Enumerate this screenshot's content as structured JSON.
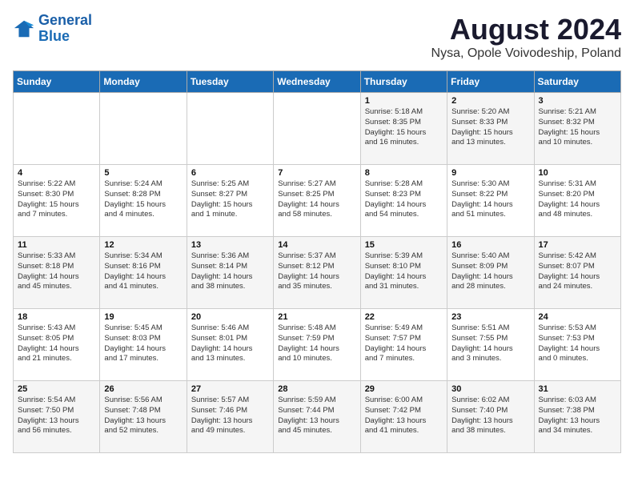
{
  "header": {
    "logo_line1": "General",
    "logo_line2": "Blue",
    "title": "August 2024",
    "subtitle": "Nysa, Opole Voivodeship, Poland"
  },
  "weekdays": [
    "Sunday",
    "Monday",
    "Tuesday",
    "Wednesday",
    "Thursday",
    "Friday",
    "Saturday"
  ],
  "weeks": [
    [
      {
        "day": "",
        "info": ""
      },
      {
        "day": "",
        "info": ""
      },
      {
        "day": "",
        "info": ""
      },
      {
        "day": "",
        "info": ""
      },
      {
        "day": "1",
        "info": "Sunrise: 5:18 AM\nSunset: 8:35 PM\nDaylight: 15 hours\nand 16 minutes."
      },
      {
        "day": "2",
        "info": "Sunrise: 5:20 AM\nSunset: 8:33 PM\nDaylight: 15 hours\nand 13 minutes."
      },
      {
        "day": "3",
        "info": "Sunrise: 5:21 AM\nSunset: 8:32 PM\nDaylight: 15 hours\nand 10 minutes."
      }
    ],
    [
      {
        "day": "4",
        "info": "Sunrise: 5:22 AM\nSunset: 8:30 PM\nDaylight: 15 hours\nand 7 minutes."
      },
      {
        "day": "5",
        "info": "Sunrise: 5:24 AM\nSunset: 8:28 PM\nDaylight: 15 hours\nand 4 minutes."
      },
      {
        "day": "6",
        "info": "Sunrise: 5:25 AM\nSunset: 8:27 PM\nDaylight: 15 hours\nand 1 minute."
      },
      {
        "day": "7",
        "info": "Sunrise: 5:27 AM\nSunset: 8:25 PM\nDaylight: 14 hours\nand 58 minutes."
      },
      {
        "day": "8",
        "info": "Sunrise: 5:28 AM\nSunset: 8:23 PM\nDaylight: 14 hours\nand 54 minutes."
      },
      {
        "day": "9",
        "info": "Sunrise: 5:30 AM\nSunset: 8:22 PM\nDaylight: 14 hours\nand 51 minutes."
      },
      {
        "day": "10",
        "info": "Sunrise: 5:31 AM\nSunset: 8:20 PM\nDaylight: 14 hours\nand 48 minutes."
      }
    ],
    [
      {
        "day": "11",
        "info": "Sunrise: 5:33 AM\nSunset: 8:18 PM\nDaylight: 14 hours\nand 45 minutes."
      },
      {
        "day": "12",
        "info": "Sunrise: 5:34 AM\nSunset: 8:16 PM\nDaylight: 14 hours\nand 41 minutes."
      },
      {
        "day": "13",
        "info": "Sunrise: 5:36 AM\nSunset: 8:14 PM\nDaylight: 14 hours\nand 38 minutes."
      },
      {
        "day": "14",
        "info": "Sunrise: 5:37 AM\nSunset: 8:12 PM\nDaylight: 14 hours\nand 35 minutes."
      },
      {
        "day": "15",
        "info": "Sunrise: 5:39 AM\nSunset: 8:10 PM\nDaylight: 14 hours\nand 31 minutes."
      },
      {
        "day": "16",
        "info": "Sunrise: 5:40 AM\nSunset: 8:09 PM\nDaylight: 14 hours\nand 28 minutes."
      },
      {
        "day": "17",
        "info": "Sunrise: 5:42 AM\nSunset: 8:07 PM\nDaylight: 14 hours\nand 24 minutes."
      }
    ],
    [
      {
        "day": "18",
        "info": "Sunrise: 5:43 AM\nSunset: 8:05 PM\nDaylight: 14 hours\nand 21 minutes."
      },
      {
        "day": "19",
        "info": "Sunrise: 5:45 AM\nSunset: 8:03 PM\nDaylight: 14 hours\nand 17 minutes."
      },
      {
        "day": "20",
        "info": "Sunrise: 5:46 AM\nSunset: 8:01 PM\nDaylight: 14 hours\nand 13 minutes."
      },
      {
        "day": "21",
        "info": "Sunrise: 5:48 AM\nSunset: 7:59 PM\nDaylight: 14 hours\nand 10 minutes."
      },
      {
        "day": "22",
        "info": "Sunrise: 5:49 AM\nSunset: 7:57 PM\nDaylight: 14 hours\nand 7 minutes."
      },
      {
        "day": "23",
        "info": "Sunrise: 5:51 AM\nSunset: 7:55 PM\nDaylight: 14 hours\nand 3 minutes."
      },
      {
        "day": "24",
        "info": "Sunrise: 5:53 AM\nSunset: 7:53 PM\nDaylight: 14 hours\nand 0 minutes."
      }
    ],
    [
      {
        "day": "25",
        "info": "Sunrise: 5:54 AM\nSunset: 7:50 PM\nDaylight: 13 hours\nand 56 minutes."
      },
      {
        "day": "26",
        "info": "Sunrise: 5:56 AM\nSunset: 7:48 PM\nDaylight: 13 hours\nand 52 minutes."
      },
      {
        "day": "27",
        "info": "Sunrise: 5:57 AM\nSunset: 7:46 PM\nDaylight: 13 hours\nand 49 minutes."
      },
      {
        "day": "28",
        "info": "Sunrise: 5:59 AM\nSunset: 7:44 PM\nDaylight: 13 hours\nand 45 minutes."
      },
      {
        "day": "29",
        "info": "Sunrise: 6:00 AM\nSunset: 7:42 PM\nDaylight: 13 hours\nand 41 minutes."
      },
      {
        "day": "30",
        "info": "Sunrise: 6:02 AM\nSunset: 7:40 PM\nDaylight: 13 hours\nand 38 minutes."
      },
      {
        "day": "31",
        "info": "Sunrise: 6:03 AM\nSunset: 7:38 PM\nDaylight: 13 hours\nand 34 minutes."
      }
    ]
  ]
}
